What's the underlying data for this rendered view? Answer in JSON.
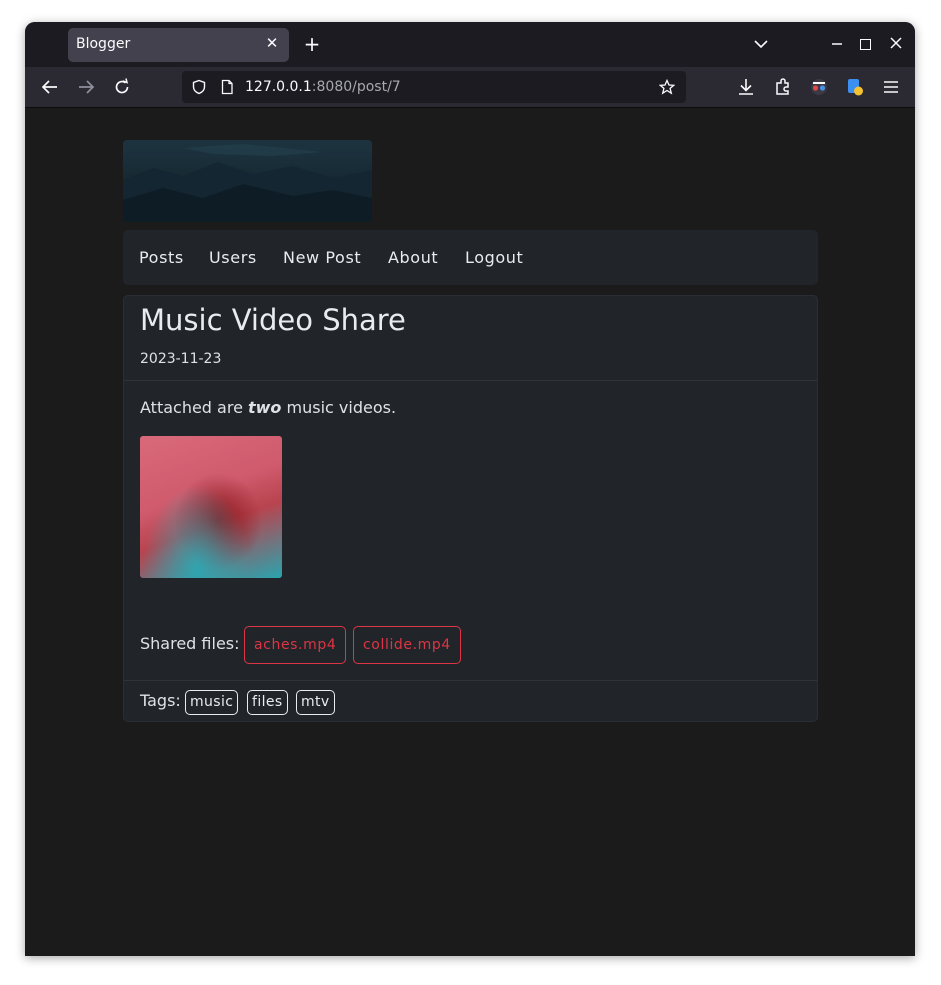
{
  "browser": {
    "tab_title": "Blogger",
    "url_host": "127.0.0.1",
    "url_rest": ":8080/post/7"
  },
  "nav": [
    "Posts",
    "Users",
    "New Post",
    "About",
    "Logout"
  ],
  "post": {
    "title": "Music Video Share",
    "date": "2023-11-23",
    "body_prefix": "Attached are ",
    "body_emphasis": "two",
    "body_suffix": " music videos.",
    "shared_label": "Shared files:",
    "files": [
      "aches.mp4",
      "collide.mp4"
    ],
    "tags_label": "Tags:",
    "tags": [
      "music",
      "files",
      "mtv"
    ]
  },
  "colors": {
    "page_bg": "#1b1b1b",
    "card_bg": "#212529",
    "file_button": "#dc3545"
  }
}
